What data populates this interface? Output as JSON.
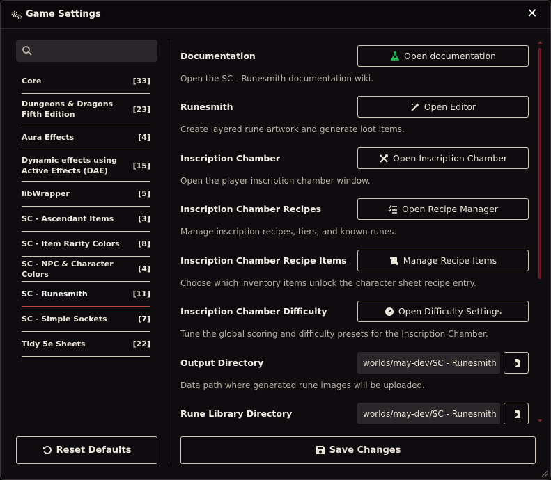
{
  "window": {
    "title": "Game Settings",
    "close_symbol": "✕"
  },
  "search": {
    "value": "",
    "placeholder": ""
  },
  "sidebar": {
    "items": [
      {
        "label": "Core",
        "count": "[33]"
      },
      {
        "label": "Dungeons & Dragons Fifth Edition",
        "count": "[23]"
      },
      {
        "label": "Aura Effects",
        "count": "[4]"
      },
      {
        "label": "Dynamic effects using Active Effects (DAE)",
        "count": "[15]"
      },
      {
        "label": "libWrapper",
        "count": "[5]"
      },
      {
        "label": "SC - Ascendant Items",
        "count": "[3]"
      },
      {
        "label": "SC - Item Rarity Colors",
        "count": "[8]"
      },
      {
        "label": "SC - NPC & Character Colors",
        "count": "[4]"
      },
      {
        "label": "SC - Runesmith",
        "count": "[11]",
        "active": true
      },
      {
        "label": "SC - Simple Sockets",
        "count": "[7]"
      },
      {
        "label": "Tidy 5e Sheets",
        "count": "[22]"
      }
    ],
    "reset_label": "Reset Defaults"
  },
  "settings": [
    {
      "name": "Documentation",
      "hint": "Open the SC - Runesmith documentation wiki.",
      "button": "Open documentation",
      "icon": "flask-icon",
      "icon_color": "#2fbf5a"
    },
    {
      "name": "Runesmith",
      "hint": "Create layered rune artwork and generate loot items.",
      "button": "Open Editor",
      "icon": "magic-wand-icon"
    },
    {
      "name": "Inscription Chamber",
      "hint": "Open the player inscription chamber window.",
      "button": "Open Inscription Chamber",
      "icon": "tools-icon"
    },
    {
      "name": "Inscription Chamber Recipes",
      "hint": "Manage inscription recipes, tiers, and known runes.",
      "button": "Open Recipe Manager",
      "icon": "list-check-icon"
    },
    {
      "name": "Inscription Chamber Recipe Items",
      "hint": "Choose which inventory items unlock the character sheet recipe entry.",
      "button": "Manage Recipe Items",
      "icon": "scroll-icon"
    },
    {
      "name": "Inscription Chamber Difficulty",
      "hint": "Tune the global scoring and difficulty presets for the Inscription Chamber.",
      "button": "Open Difficulty Settings",
      "icon": "gauge-icon"
    },
    {
      "name": "Output Directory",
      "hint": "Data path where generated rune images will be uploaded.",
      "path_value": "worlds/may-dev/SC - Runesmith",
      "icon": "file-import-icon"
    },
    {
      "name": "Rune Library Directory",
      "path_value": "worlds/may-dev/SC - Runesmith",
      "icon": "file-import-icon"
    }
  ],
  "save_label": "Save Changes",
  "colors": {
    "accent": "#c24a3a",
    "scrollbar": "#6d1826",
    "background": "#0f0c10"
  }
}
